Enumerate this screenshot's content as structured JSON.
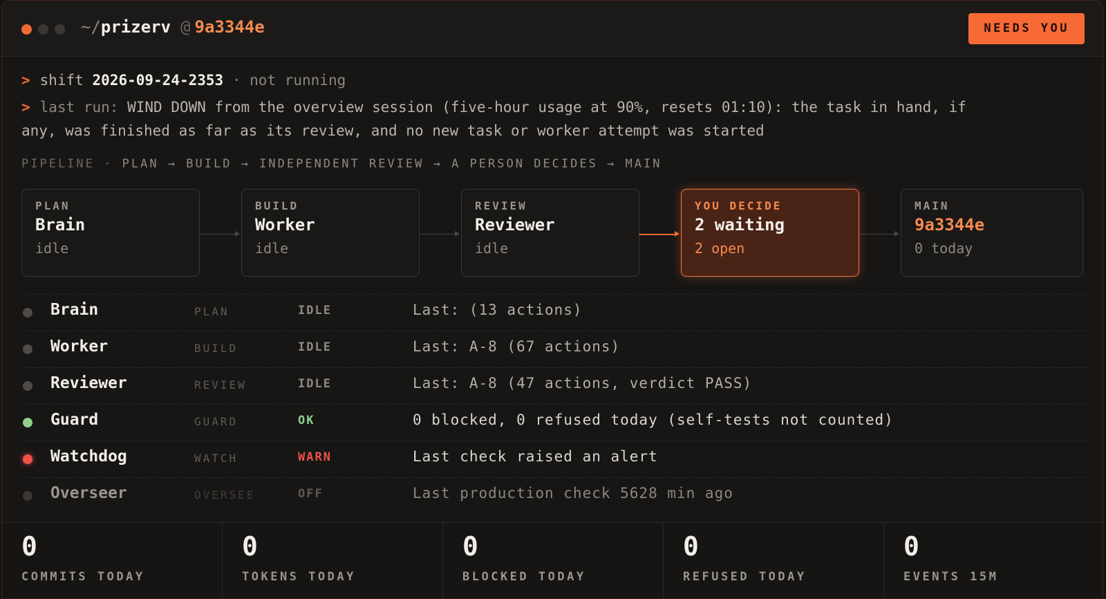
{
  "titlebar": {
    "path_prefix": "~/",
    "repo": "prizerv",
    "at": "@",
    "commit": "9a3344e",
    "needs_button": "NEEDS YOU"
  },
  "status": {
    "prompt": ">",
    "shift_label": "shift",
    "shift_id": "2026-09-24-2353",
    "separator": "·",
    "shift_state": "not running",
    "last_run_label": "last run:",
    "last_run_text": "WIND DOWN from the overview session (five-hour usage at 90%, resets 01:10): the task in hand, if",
    "last_run_text_2": "any, was finished as far as its review, and no new task or worker attempt was started"
  },
  "pipeline": {
    "label": "PIPELINE",
    "sep": "·",
    "flow": "PLAN → BUILD → INDEPENDENT REVIEW → A PERSON DECIDES → MAIN",
    "stages": [
      {
        "label": "PLAN",
        "name": "Brain",
        "sub": "idle"
      },
      {
        "label": "BUILD",
        "name": "Worker",
        "sub": "idle"
      },
      {
        "label": "REVIEW",
        "name": "Reviewer",
        "sub": "idle"
      },
      {
        "label": "YOU DECIDE",
        "name": "2 waiting",
        "sub": "2 open"
      },
      {
        "label": "MAIN",
        "name": "9a3344e",
        "sub": "0 today"
      }
    ]
  },
  "agents": [
    {
      "name": "Brain",
      "role": "PLAN",
      "state": "IDLE",
      "detail": "Last: (13 actions)"
    },
    {
      "name": "Worker",
      "role": "BUILD",
      "state": "IDLE",
      "detail": "Last: A-8 (67 actions)"
    },
    {
      "name": "Reviewer",
      "role": "REVIEW",
      "state": "IDLE",
      "detail": "Last: A-8 (47 actions, verdict PASS)"
    },
    {
      "name": "Guard",
      "role": "GUARD",
      "state": "OK",
      "detail": "0 blocked, 0 refused today (self-tests not counted)"
    },
    {
      "name": "Watchdog",
      "role": "WATCH",
      "state": "WARN",
      "detail": "Last check raised an alert"
    },
    {
      "name": "Overseer",
      "role": "OVERSEE",
      "state": "OFF",
      "detail": "Last production check 5628 min ago"
    }
  ],
  "stats": [
    {
      "value": "0",
      "caption": "COMMITS TODAY"
    },
    {
      "value": "0",
      "caption": "TOKENS TODAY"
    },
    {
      "value": "0",
      "caption": "BLOCKED TODAY"
    },
    {
      "value": "0",
      "caption": "REFUSED TODAY"
    },
    {
      "value": "0",
      "caption": "EVENTS 15M"
    }
  ],
  "colors": {
    "accent": "#f26a33",
    "ok": "#8fd08f",
    "warn": "#f0524a"
  }
}
